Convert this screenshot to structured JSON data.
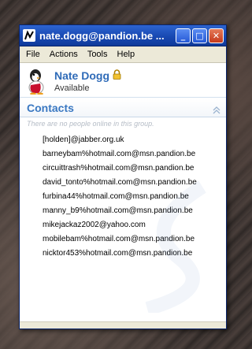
{
  "window": {
    "title": "nate.dogg@pandion.be ...",
    "controls": {
      "minimize": "_",
      "maximize": "□",
      "close": "✕"
    }
  },
  "menu": [
    "File",
    "Actions",
    "Tools",
    "Help"
  ],
  "profile": {
    "name": "Nate Dogg",
    "status": "Available"
  },
  "group": {
    "title": "Contacts",
    "empty_message": "There are no people online in this group."
  },
  "contacts": [
    "[holden]@jabber.org.uk",
    "barneybam%hotmail.com@msn.pandion.be",
    "circuittrash%hotmail.com@msn.pandion.be",
    "david_tonto%hotmail.com@msn.pandion.be",
    "furbina44%hotmail.com@msn.pandion.be",
    "manny_b9%hotmail.com@msn.pandion.be",
    "mikejackaz2002@yahoo.com",
    "mobilebam%hotmail.com@msn.pandion.be",
    "nicktor453%hotmail.com@msn.pandion.be"
  ],
  "icons": {
    "app": "pandion-logo-icon",
    "avatar": "penguin-avatar-icon",
    "lock": "lock-icon",
    "collapse": "collapse-chevron-icon"
  },
  "colors": {
    "titlebar": "#1747b0",
    "accent": "#2f6bb8",
    "menubar": "#ece9d8"
  }
}
